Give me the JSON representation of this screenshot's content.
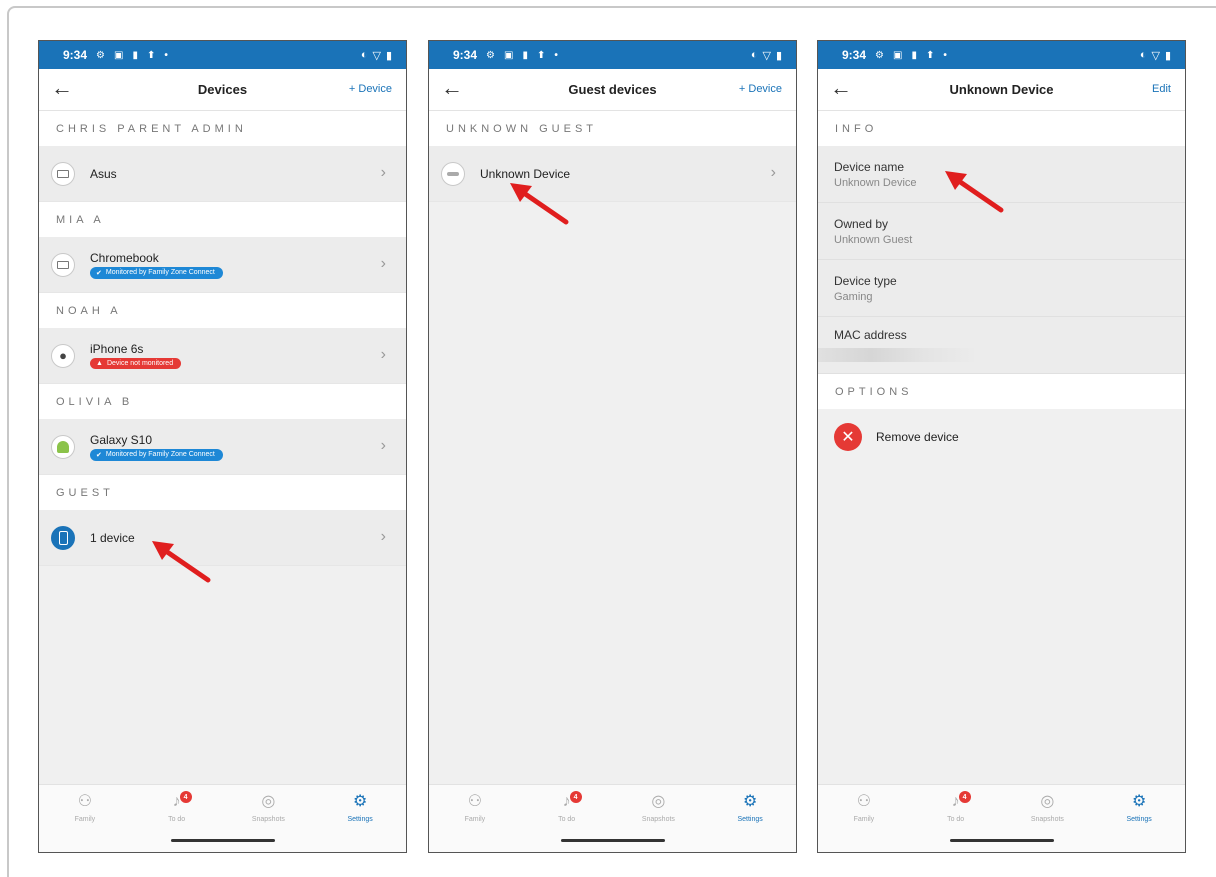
{
  "status": {
    "time": "9:34",
    "left_icons": [
      "⚙",
      "▣",
      "▮",
      "⬆",
      "•"
    ],
    "right_icons": [
      "◐",
      "▽",
      "▮"
    ]
  },
  "screens": [
    {
      "back": "←",
      "title": "Devices",
      "action": "+ Device",
      "groups": [
        {
          "section": "CHRIS PARENT ADMIN",
          "devices": [
            {
              "name": "Asus",
              "icon": "laptop-icon"
            }
          ]
        },
        {
          "section": "MIA A",
          "devices": [
            {
              "name": "Chromebook",
              "icon": "laptop-icon",
              "badge": "Monitored by Family Zone Connect",
              "badge_color": "#1e88d6"
            }
          ]
        },
        {
          "section": "NOAH A",
          "devices": [
            {
              "name": "iPhone 6s",
              "icon": "apple-icon",
              "badge": "Device not monitored",
              "badge_color": "#e53935"
            }
          ]
        },
        {
          "section": "OLIVIA B",
          "devices": [
            {
              "name": "Galaxy S10",
              "icon": "android-icon",
              "badge": "Monitored by Family Zone Connect",
              "badge_color": "#1e88d6"
            }
          ]
        },
        {
          "section": "GUEST",
          "devices": [
            {
              "name": "1 device",
              "icon": "phone-icon"
            }
          ]
        }
      ]
    },
    {
      "back": "←",
      "title": "Guest devices",
      "action": "+ Device",
      "groups": [
        {
          "section": "UNKNOWN GUEST",
          "devices": [
            {
              "name": "Unknown Device",
              "icon": "gaming-icon"
            }
          ]
        }
      ]
    },
    {
      "back": "←",
      "title": "Unknown Device",
      "action": "Edit",
      "info_section": "INFO",
      "info": [
        {
          "label": "Device name",
          "value": "Unknown Device"
        },
        {
          "label": "Owned by",
          "value": "Unknown Guest"
        },
        {
          "label": "Device type",
          "value": "Gaming"
        },
        {
          "label": "MAC address",
          "value": ""
        }
      ],
      "options_section": "OPTIONS",
      "remove_label": "Remove device"
    }
  ],
  "nav": [
    {
      "label": "Family",
      "icon": "family-icon"
    },
    {
      "label": "To do",
      "icon": "bell-icon",
      "badge": "4"
    },
    {
      "label": "Snapshots",
      "icon": "snapshots-icon"
    },
    {
      "label": "Settings",
      "icon": "gear-icon",
      "active": true
    }
  ],
  "chevron": "›",
  "check_glyph": "✔",
  "warn_glyph": "▲",
  "remove_glyph": "✕",
  "colors": {
    "primary": "#1a73b8",
    "danger": "#e53935",
    "annotation_arrow": "#e01e1e"
  }
}
